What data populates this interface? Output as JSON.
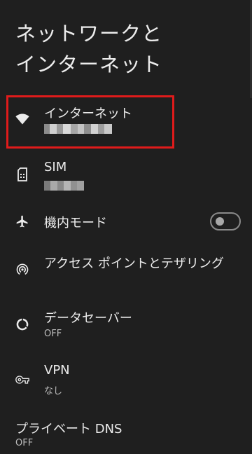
{
  "header": {
    "title_line1": "ネットワークと",
    "title_line2": "インターネット"
  },
  "items": [
    {
      "title": "インターネット",
      "icon": "wifi-icon"
    },
    {
      "title": "SIM",
      "icon": "sim-card-icon"
    },
    {
      "title": "機内モード",
      "icon": "airplane-icon",
      "toggle_on": false
    },
    {
      "title": "アクセス ポイントとテザリング",
      "icon": "hotspot-icon"
    },
    {
      "title": "データセーバー",
      "subtitle": "OFF",
      "icon": "data-saver-icon"
    },
    {
      "title": "VPN",
      "subtitle": "なし",
      "icon": "vpn-key-icon"
    },
    {
      "title": "プライベート DNS",
      "subtitle": "OFF"
    }
  ],
  "colors": {
    "background": "#1f1f1f",
    "highlight": "#e01b1b",
    "text": "#ececec",
    "subtext": "#bdbdbd"
  }
}
